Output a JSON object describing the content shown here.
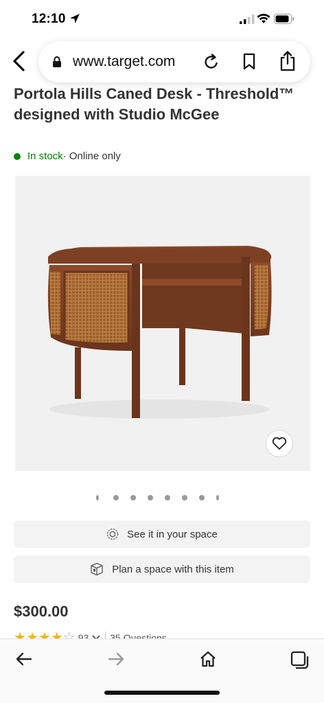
{
  "status_bar": {
    "time": "12:10",
    "icons": [
      "location-arrow-icon",
      "cellular-signal-icon",
      "wifi-icon",
      "battery-icon"
    ]
  },
  "browser": {
    "url": "www.target.com",
    "icons": [
      "back-chevron-icon",
      "lock-icon",
      "reload-icon",
      "bookmark-icon",
      "share-icon"
    ]
  },
  "product": {
    "title": "Portola Hills Caned Desk - Threshold™ designed with Studio McGee",
    "stock_status": "In stock",
    "availability": " · Online only",
    "image_count": 8,
    "active_image_index": 0,
    "see_in_space_label": "See it in your space",
    "plan_space_label": "Plan a space with this item",
    "price": "$300.00",
    "rating": 4,
    "rating_count": "93",
    "questions_label": "35 Questions"
  },
  "toolbar": {
    "icons": [
      "back-arrow-icon",
      "forward-arrow-icon",
      "home-icon",
      "tabs-icon"
    ]
  },
  "colors": {
    "in_stock_green": "#008300",
    "star_gold": "#f2b311",
    "button_bg": "#f3f3f3"
  }
}
